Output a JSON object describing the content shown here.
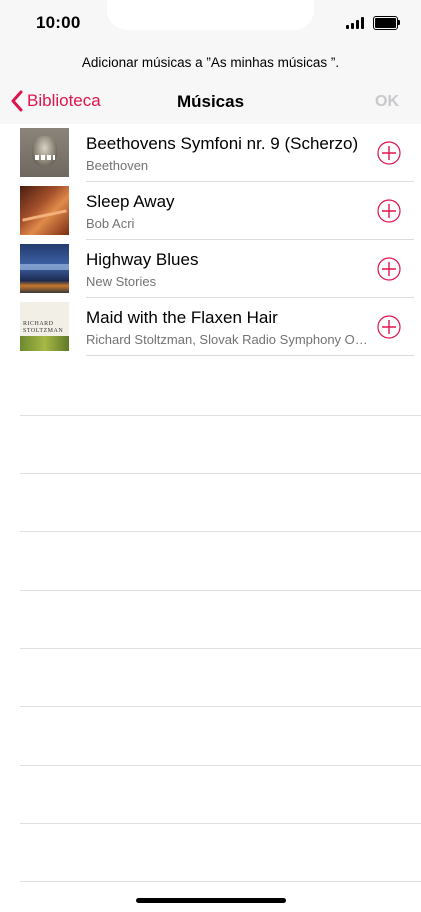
{
  "status_bar": {
    "time": "10:00"
  },
  "header": {
    "prompt": "Adicionar músicas a ”As minhas músicas ”.",
    "back_label": "Biblioteca",
    "title": "Músicas",
    "ok_label": "OK"
  },
  "songs": [
    {
      "title": "Beethovens Symfoni nr. 9 (Scherzo)",
      "artist": "Beethoven"
    },
    {
      "title": "Sleep Away",
      "artist": "Bob Acri"
    },
    {
      "title": "Highway Blues",
      "artist": "New Stories"
    },
    {
      "title": "Maid with the Flaxen Hair",
      "artist": "Richard Stoltzman, Slovak Radio Symphony Orchestra & Ondrej Lenárd"
    }
  ],
  "artwork_text": {
    "maid_line1": "RICHARD",
    "maid_line2": "STOLTZMAN"
  },
  "colors": {
    "accent": "#e0144c",
    "disabled": "#c9c9cd",
    "secondary_text": "#737373"
  },
  "icons": [
    "chevron-left-icon",
    "add-circle-icon",
    "signal-icon",
    "battery-icon"
  ]
}
